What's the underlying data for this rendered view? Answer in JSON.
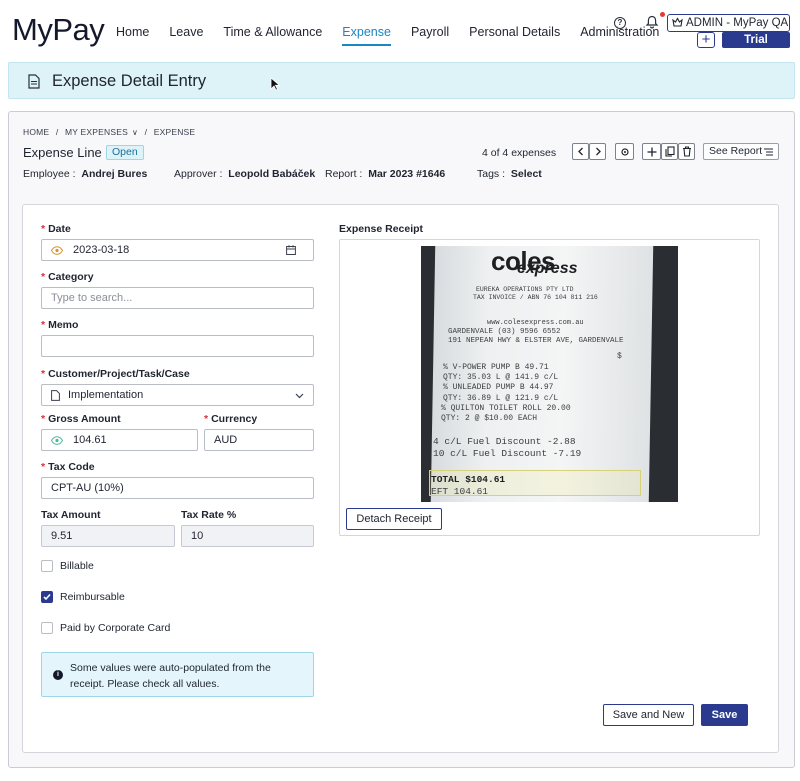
{
  "app": {
    "logo": "MyPay"
  },
  "nav": {
    "items": [
      {
        "label": "Home"
      },
      {
        "label": "Leave"
      },
      {
        "label": "Time & Allowance"
      },
      {
        "label": "Expense"
      },
      {
        "label": "Payroll"
      },
      {
        "label": "Personal Details"
      },
      {
        "label": "Administration"
      }
    ],
    "active": "Expense"
  },
  "user": {
    "role_label": "ADMIN  -  MyPay QA",
    "trial_label": "Trial Version",
    "add_label": "+"
  },
  "page": {
    "title": "Expense Detail Entry"
  },
  "breadcrumb": {
    "home": "HOME",
    "sep1": "/",
    "my_expenses": "MY EXPENSES",
    "sep2": "/",
    "expense": "EXPENSE"
  },
  "expense_line": {
    "title": "Expense Line",
    "status": "Open",
    "counter": "4 of 4 expenses",
    "see_report": "See Report",
    "employee_label": "Employee :",
    "employee": "Andrej Bures",
    "approver_label": "Approver :",
    "approver": "Leopold Babáček",
    "report_label": "Report :",
    "report": "Mar 2023 #1646",
    "tags_label": "Tags :",
    "tags": "Select"
  },
  "form": {
    "date_label": "Date",
    "date_value": "2023-03-18",
    "category_label": "Category",
    "category_placeholder": "Type to search...",
    "memo_label": "Memo",
    "memo_value": "",
    "customer_label": "Customer/Project/Task/Case",
    "customer_value": "Implementation",
    "gross_label": "Gross Amount",
    "gross_value": "104.61",
    "currency_label": "Currency",
    "currency_value": "AUD",
    "tax_code_label": "Tax Code",
    "tax_code_value": "CPT-AU (10%)",
    "tax_amount_label": "Tax Amount",
    "tax_amount_value": "9.51",
    "tax_rate_label": "Tax Rate %",
    "tax_rate_value": "10",
    "billable_label": "Billable",
    "billable_checked": false,
    "reimbursable_label": "Reimbursable",
    "reimbursable_checked": true,
    "corporate_label": "Paid by Corporate Card",
    "corporate_checked": false,
    "info_message": "Some values were auto-populated from the receipt. Please check all values."
  },
  "receipt": {
    "title": "Expense Receipt",
    "detach_label": "Detach Receipt",
    "lines": {
      "brand1": "coles",
      "brand2": "express",
      "l1": "EUREKA OPERATIONS PTY LTD",
      "l2": "TAX INVOICE / ABN 76 104 811 216",
      "l3": "www.colesexpress.com.au",
      "l4": "GARDENVALE              (03) 9596 6552",
      "l5": "191 NEPEAN HWY & ELSTER AVE, GARDENVALE",
      "l6": "$",
      "l7": "% V-POWER            PUMP B     49.71",
      "l8": "   QTY: 35.03   L  @ 141.9 c/L",
      "l9": "% UNLEADED           PUMP B     44.97",
      "l10": "   QTY: 36.89   L  @ 121.9 c/L",
      "l11": "% QUILTON TOILET ROLL           20.00",
      "l12": "   QTY: 2   @  $10.00 EACH",
      "l13": "4 c/L Fuel Discount      -2.88",
      "l14": "10 c/L Fuel Discount     -7.19",
      "l15": "TOTAL                  $104.61",
      "l16": "EFT                     104.61"
    }
  },
  "actions": {
    "save_new": "Save and New",
    "save": "Save"
  }
}
